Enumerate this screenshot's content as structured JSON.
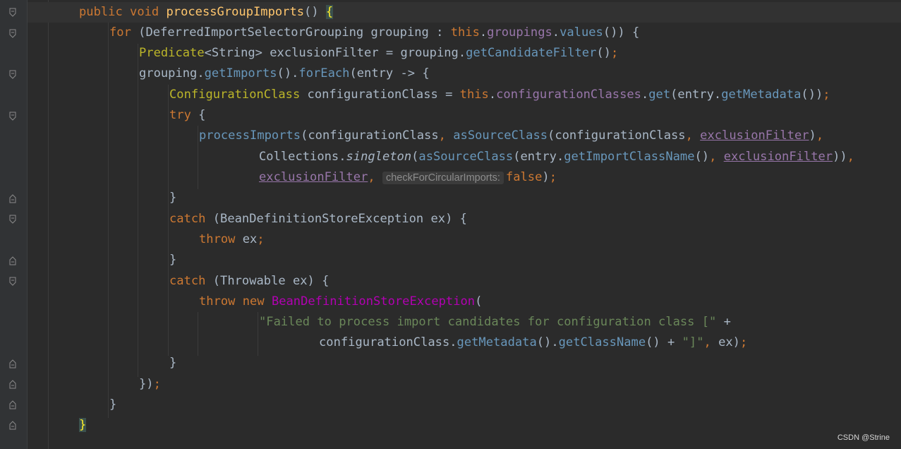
{
  "code": {
    "method_signature": {
      "kw": "public void ",
      "name": "processGroupImports",
      "rest": "() ",
      "brace": "{"
    },
    "for_line": {
      "kw1": "for ",
      "p1": "(DeferredImportSelectorGrouping grouping : ",
      "kw2": "this",
      "p2": ".",
      "field": "groupings",
      "p3": ".",
      "m": "values",
      "p4": "()) {"
    },
    "predicate_line": {
      "type": "Predicate",
      "p1": "<String> exclusionFilter = grouping.",
      "m": "getCandidateFilter",
      "p2": "()",
      "semi": ";"
    },
    "foreach_line": {
      "p1": "grouping.",
      "m1": "getImports",
      "p2": "().",
      "m2": "forEach",
      "p3": "(entry -> {"
    },
    "config_line": {
      "type": "ConfigurationClass",
      "p1": " configurationClass = ",
      "kw": "this",
      "p2": ".",
      "field": "configurationClasses",
      "p3": ".",
      "m1": "get",
      "p4": "(entry.",
      "m2": "getMetadata",
      "p5": "())",
      "semi": ";"
    },
    "try_line": {
      "kw": "try",
      "p": " {"
    },
    "process_line": {
      "m1": "processImports",
      "p1": "(configurationClass",
      "c1": ", ",
      "m2": "asSourceClass",
      "p2": "(configurationClass",
      "c2": ", ",
      "ul": "exclusionFilter",
      "p3": ")",
      "c3": ","
    },
    "collections_line": {
      "p1": "Collections.",
      "it": "singleton",
      "p2": "(",
      "m1": "asSourceClass",
      "p3": "(entry.",
      "m2": "getImportClassName",
      "p4": "()",
      "c1": ", ",
      "ul": "exclusionFilter",
      "p5": "))",
      "c2": ","
    },
    "exclusion_line": {
      "ul": "exclusionFilter",
      "c1": ",",
      "hint": "checkForCircularImports:",
      "kw": "false",
      "p": ")",
      "semi": ";"
    },
    "close1": "}",
    "catch1_line": {
      "kw": "catch",
      "p": " (BeanDefinitionStoreException ex) {"
    },
    "throw1_line": {
      "kw": "throw",
      "p": " ex",
      "semi": ";"
    },
    "close2": "}",
    "catch2_line": {
      "kw": "catch",
      "p": " (Throwable ex) {"
    },
    "throw2_line": {
      "kw1": "throw",
      "sp": " ",
      "kw2": "new",
      "sp2": " ",
      "ctor": "BeanDefinitionStoreException",
      "p": "("
    },
    "string_line": {
      "str": "\"Failed to process import candidates for configuration class [\"",
      "p": " +"
    },
    "concat_line": {
      "p1": "configurationClass.",
      "m1": "getMetadata",
      "p2": "().",
      "m2": "getClassName",
      "p3": "() + ",
      "str": "\"]\"",
      "c": ", ",
      "p4": "ex)",
      "semi": ";"
    },
    "close3": "}",
    "close_lambda": {
      "p": "})",
      "semi": ";"
    },
    "close_for": "}",
    "close_method": "}"
  },
  "watermark": "CSDN @Strine",
  "colors": {
    "background": "#2b2b2b",
    "keyword": "#cc7832",
    "method": "#6897bb",
    "declaration": "#ffc66d",
    "string": "#6a8759",
    "field": "#9876aa",
    "constructor": "#b200b2"
  }
}
